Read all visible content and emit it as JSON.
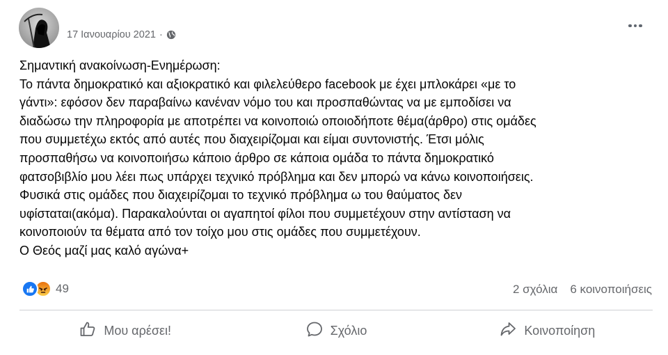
{
  "post": {
    "date": "17 Ιανουαρίου 2021",
    "separator": "·",
    "privacy_icon": "globe-icon",
    "more_icon": "more-options-icon",
    "lines": [
      "Σημαντική ανακοίνωση-Ενημέρωση:",
      "Το πάντα δημοκρατικό και αξιοκρατικό και φιλελεύθερο facebook με έχει μπλοκάρει «με το",
      "γάντι»: εφόσον δεν παραβαίνω κανέναν νόμο του και προσπαθώντας να με εμποδίσει να",
      "διαδώσω την πληροφορία με αποτρέπει να κοινοποιώ οποιοδήποτε θέμα(άρθρο) στις ομάδες",
      "που συμμετέχω εκτός από αυτές που διαχειρίζομαι και είμαι συντονιστής. Έτσι μόλις",
      "προσπαθήσω να κοινοποιήσω κάποιο άρθρο σε κάποια ομάδα το πάντα δημοκρατικό",
      "φατσοβιβλίο μου λέει πως υπάρχει τεχνικό πρόβλημα και δεν μπορώ να κάνω κοινοποιήσεις.",
      "Φυσικά στις ομάδες που διαχειρίζομαι το τεχνικό πρόβλημα ω του θαύματος δεν",
      "υφίσταται(ακόμα). Παρακαλούνται οι αγαπητοί φίλοι που συμμετέχουν στην αντίσταση να",
      "κοινοποιούν τα θέματα από τον τοίχο μου στις ομάδες που συμμετέχουν.",
      "Ο Θεός μαζί μας καλό αγώνα+"
    ]
  },
  "reactions": {
    "types": [
      "like-reaction-icon",
      "angry-reaction-icon"
    ],
    "count": "49",
    "comments": "2 σχόλια",
    "shares": "6 κοινοποιήσεις"
  },
  "actions": {
    "like": "Μου αρέσει!",
    "comment": "Σχόλιο",
    "share": "Κοινοποίηση"
  },
  "colors": {
    "text": "#050505",
    "secondary": "#65676b",
    "like_blue": "#1877f2",
    "divider": "#ced0d4"
  }
}
